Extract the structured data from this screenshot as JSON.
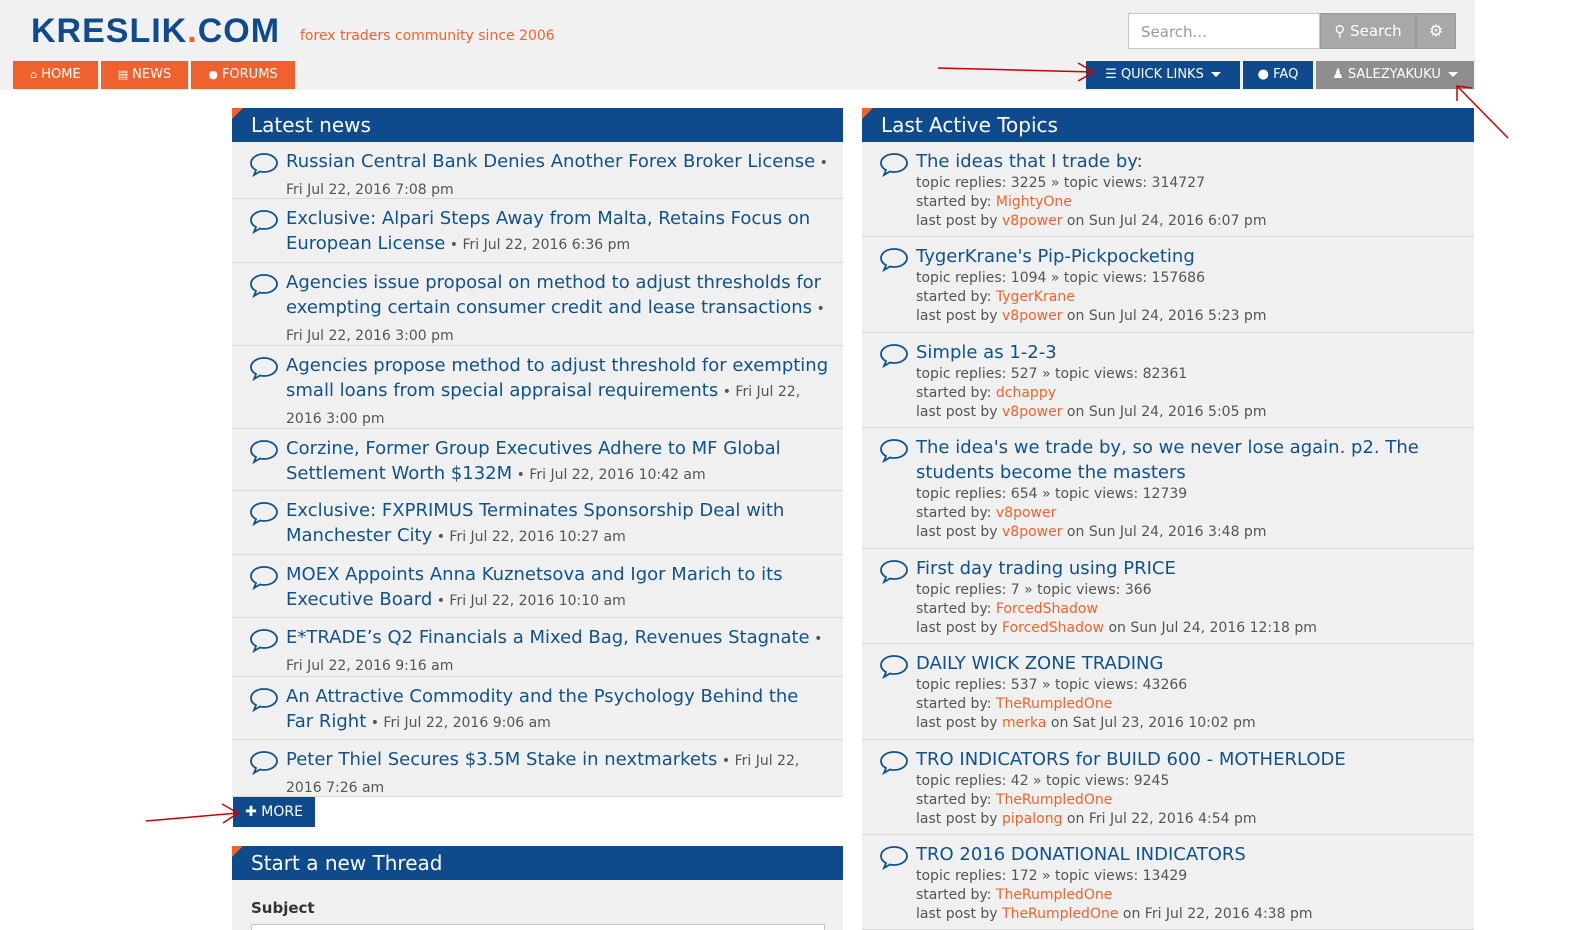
{
  "brand": {
    "logo_main": "KRESLIK",
    "logo_dot": ".",
    "logo_tld": "COM",
    "tagline": "forex traders community since 2006"
  },
  "search": {
    "placeholder": "Search...",
    "button_label": "Search"
  },
  "nav": {
    "home": "HOME",
    "news": "NEWS",
    "forums": "FORUMS"
  },
  "right_nav": {
    "quick_links": "QUICK LINKS",
    "faq": "FAQ",
    "user": "SALEZYAKUKU"
  },
  "latest_news": {
    "title": "Latest news",
    "items": [
      {
        "title": "Russian Central Bank Denies Another Forex Broker License",
        "date": "Fri Jul 22, 2016 7:08 pm"
      },
      {
        "title": "Exclusive: Alpari Steps Away from Malta, Retains Focus on European License",
        "date": "Fri Jul 22, 2016 6:36 pm"
      },
      {
        "title": "Agencies issue proposal on method to adjust thresholds for exempting certain consumer credit and lease transactions",
        "date": "Fri Jul 22, 2016 3:00 pm"
      },
      {
        "title": "Agencies propose method to adjust threshold for exempting small loans from special appraisal requirements",
        "date": "Fri Jul 22, 2016 3:00 pm"
      },
      {
        "title": "Corzine, Former Group Executives Adhere to MF Global Settlement Worth $132M",
        "date": "Fri Jul 22, 2016 10:42 am"
      },
      {
        "title": "Exclusive: FXPRIMUS Terminates Sponsorship Deal with Manchester City",
        "date": "Fri Jul 22, 2016 10:27 am"
      },
      {
        "title": "MOEX Appoints Anna Kuznetsova and Igor Marich to its Executive Board",
        "date": "Fri Jul 22, 2016 10:10 am"
      },
      {
        "title": "E*TRADE’s Q2 Financials a Mixed Bag, Revenues Stagnate",
        "date": "Fri Jul 22, 2016 9:16 am"
      },
      {
        "title": "An Attractive Commodity and the Psychology Behind the Far Right",
        "date": "Fri Jul 22, 2016 9:06 am"
      },
      {
        "title": "Peter Thiel Secures $3.5M Stake in nextmarkets",
        "date": "Fri Jul 22, 2016 7:26 am"
      }
    ],
    "more_label": "MORE"
  },
  "new_thread": {
    "title": "Start a new Thread",
    "subject_label": "Subject"
  },
  "active_topics": {
    "title": "Last Active Topics",
    "labels": {
      "replies": "topic replies:",
      "sep": "»",
      "views": "topic views:",
      "started": "started by:",
      "last_post": "last post by",
      "on": "on"
    },
    "items": [
      {
        "title": "The ideas that I trade by:",
        "replies": "3225",
        "views": "314727",
        "starter": "MightyOne",
        "last_user": "v8power",
        "last_date": "Sun Jul 24, 2016 6:07 pm"
      },
      {
        "title": "TygerKrane's Pip-Pickpocketing",
        "replies": "1094",
        "views": "157686",
        "starter": "TygerKrane",
        "last_user": "v8power",
        "last_date": "Sun Jul 24, 2016 5:23 pm"
      },
      {
        "title": "Simple as 1-2-3",
        "replies": "527",
        "views": "82361",
        "starter": "dchappy",
        "last_user": "v8power",
        "last_date": "Sun Jul 24, 2016 5:05 pm"
      },
      {
        "title": "The idea's we trade by, so we never lose again. p2. The students become the masters",
        "replies": "654",
        "views": "12739",
        "starter": "v8power",
        "last_user": "v8power",
        "last_date": "Sun Jul 24, 2016 3:48 pm"
      },
      {
        "title": "First day trading using PRICE",
        "replies": "7",
        "views": "366",
        "starter": "ForcedShadow",
        "last_user": "ForcedShadow",
        "last_date": "Sun Jul 24, 2016 12:18 pm"
      },
      {
        "title": "DAILY WICK ZONE TRADING",
        "replies": "537",
        "views": "43266",
        "starter": "TheRumpledOne",
        "last_user": "merka",
        "last_date": "Sat Jul 23, 2016 10:02 pm"
      },
      {
        "title": "TRO INDICATORS for BUILD 600 - MOTHERLODE",
        "replies": "42",
        "views": "9245",
        "starter": "TheRumpledOne",
        "last_user": "pipalong",
        "last_date": "Fri Jul 22, 2016 4:54 pm"
      },
      {
        "title": "TRO 2016 DONATIONAL INDICATORS",
        "replies": "172",
        "views": "13429",
        "starter": "TheRumpledOne",
        "last_user": "TheRumpledOne",
        "last_date": "Fri Jul 22, 2016 4:38 pm"
      }
    ]
  },
  "colors": {
    "brand_blue": "#0f4b8c",
    "brand_orange": "#f0622d",
    "link_blue": "#105289",
    "annotation_red": "#cc0000"
  }
}
